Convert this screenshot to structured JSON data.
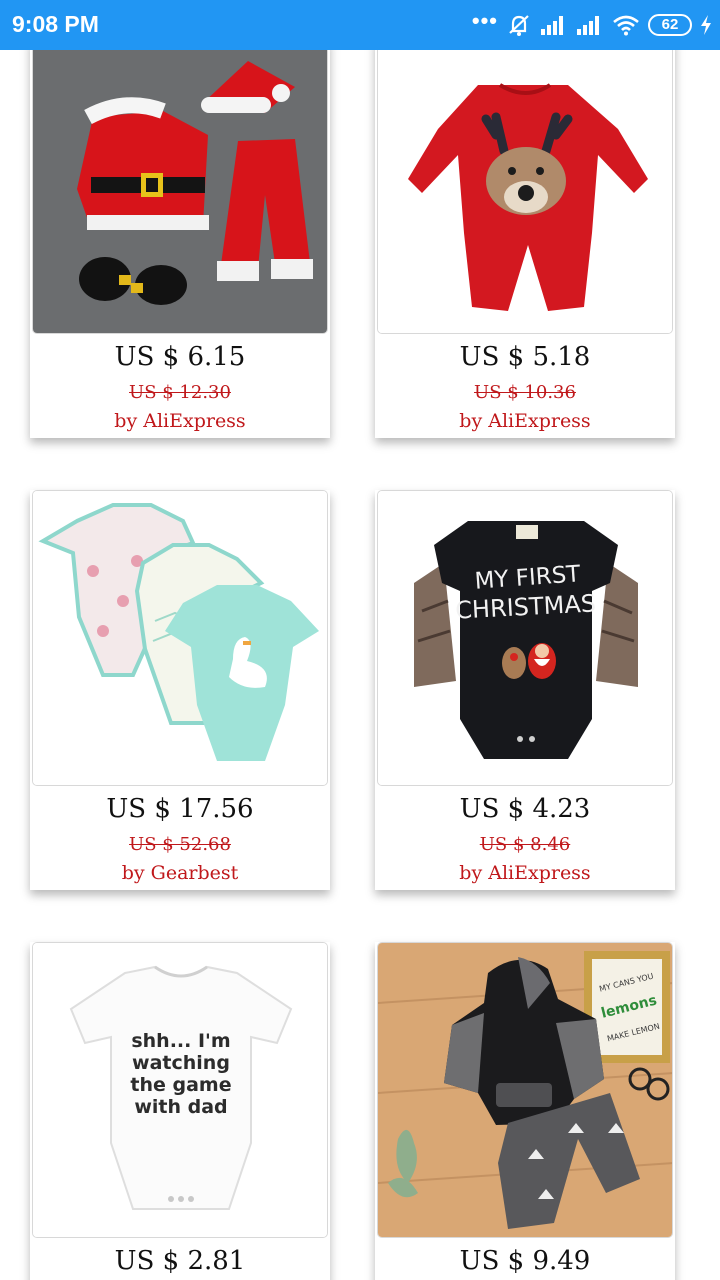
{
  "status_bar": {
    "time": "9:08 PM",
    "dots": "•••",
    "battery": "62"
  },
  "products": [
    {
      "price": "US $ 6.15",
      "old_price": "US $ 12.30",
      "seller": "by AliExpress",
      "image": "santa-outfit"
    },
    {
      "price": "US $ 5.18",
      "old_price": "US $ 10.36",
      "seller": "by AliExpress",
      "image": "reindeer-romper"
    },
    {
      "price": "US $ 17.56",
      "old_price": "US $ 52.68",
      "seller": "by Gearbest",
      "image": "bodysuit-set"
    },
    {
      "price": "US $ 4.23",
      "old_price": "US $ 8.46",
      "seller": "by AliExpress",
      "image": "first-christmas-bodysuit",
      "print": [
        "MY FIRST",
        "CHRISTMAS"
      ]
    },
    {
      "price": "US $ 2.81",
      "image": "watching-game-bodysuit",
      "print": [
        "shh... I'm",
        "watching",
        "the game",
        "with dad"
      ]
    },
    {
      "price": "US $ 9.49",
      "image": "hoodie-pants-set",
      "sign_text": [
        "MY CANS YOU",
        "lemons",
        "MAKE LEMON"
      ]
    }
  ]
}
